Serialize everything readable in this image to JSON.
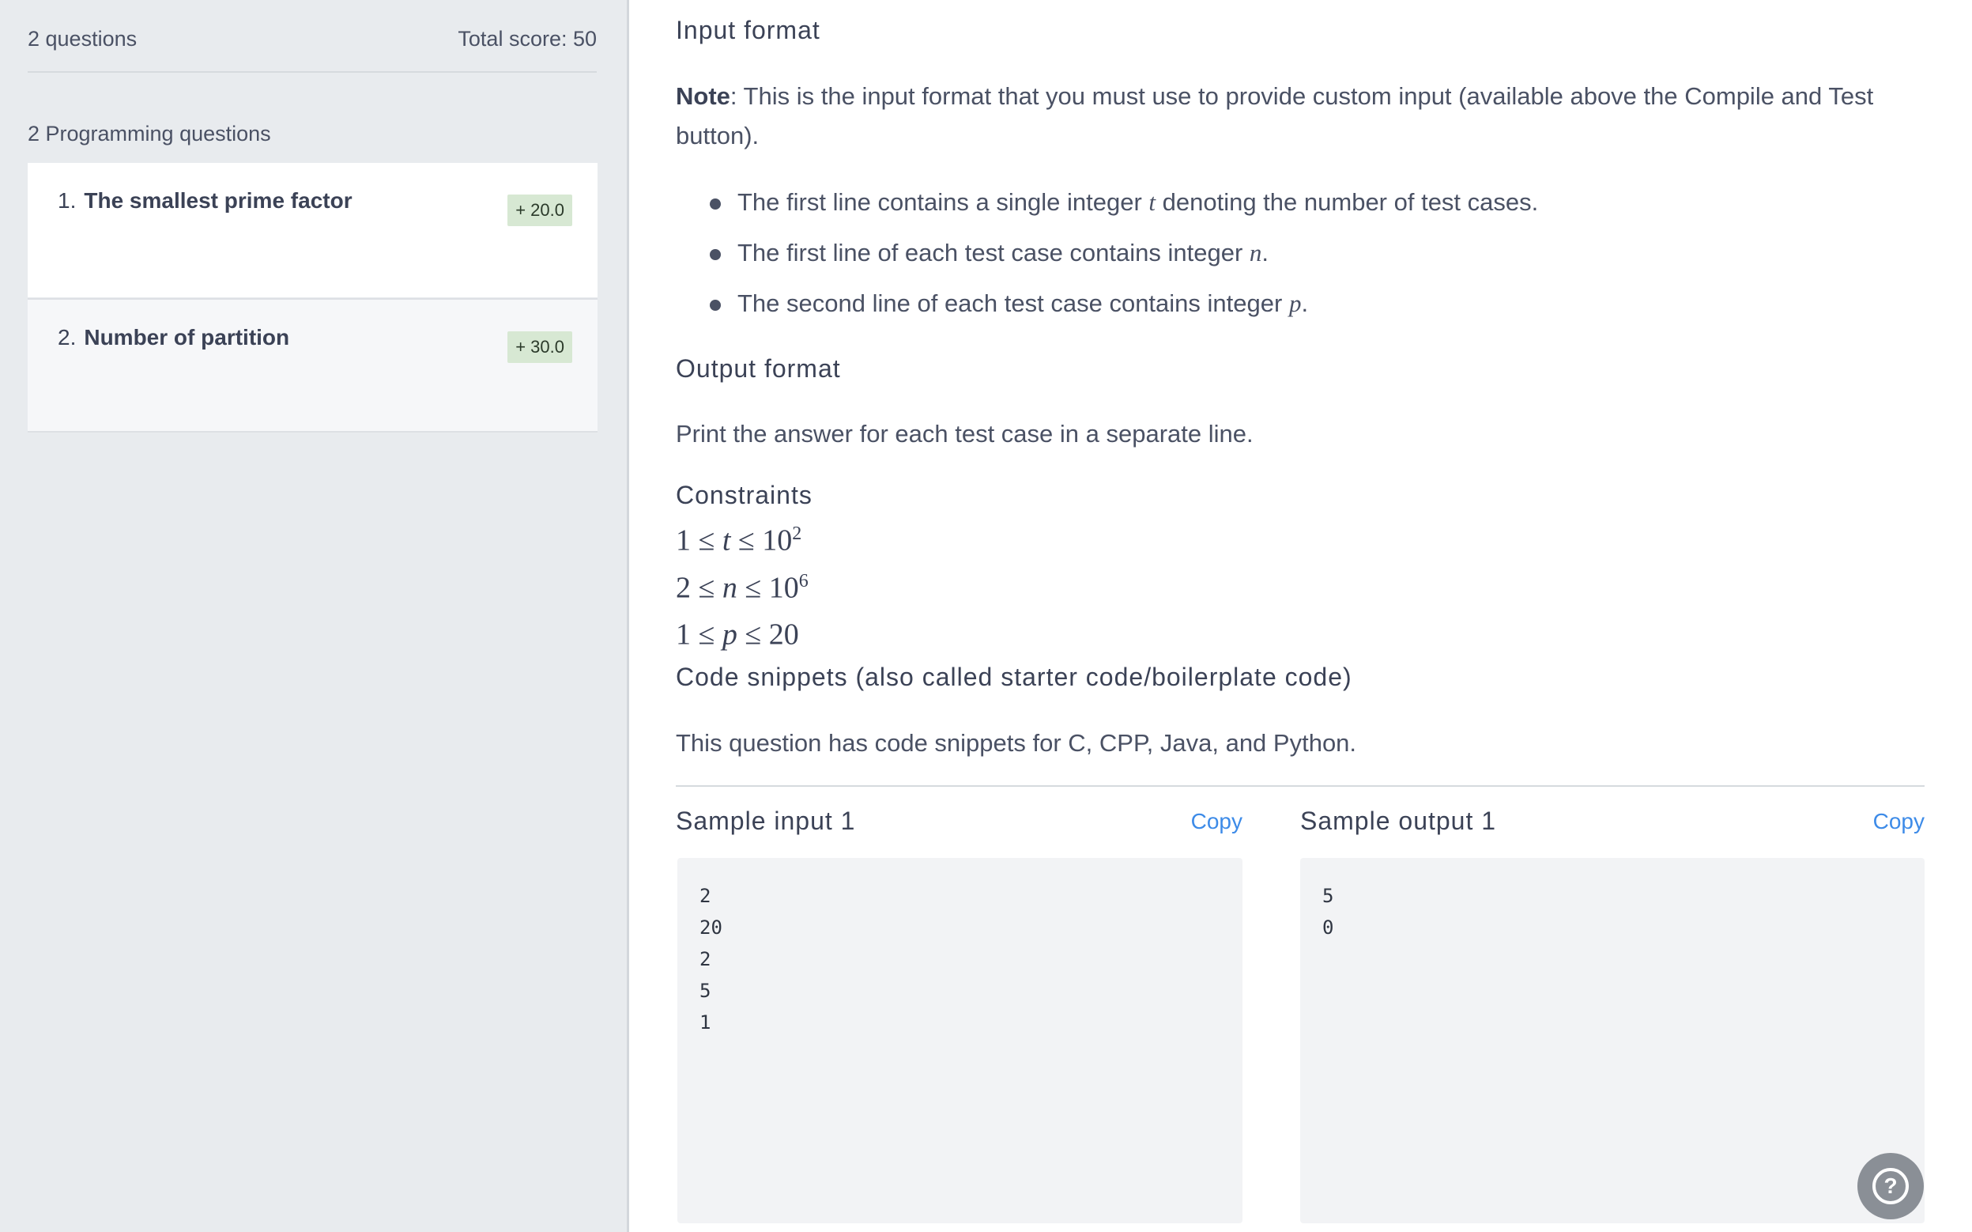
{
  "sidebar": {
    "question_count": "2 questions",
    "total_score": "Total score: 50",
    "section_label": "2 Programming questions",
    "questions": [
      {
        "number": "1.",
        "title": "The smallest prime factor",
        "score": "+ 20.0"
      },
      {
        "number": "2.",
        "title": "Number of partition",
        "score": "+ 30.0"
      }
    ]
  },
  "main": {
    "input_format": {
      "heading": "Input format",
      "note_label": "Note",
      "note_text": ": This is the input format that you must use to provide custom input (available above the Compile and Test button).",
      "bullets": [
        {
          "pre": "The first line contains a single integer ",
          "var": "t",
          "post": " denoting the number of test cases."
        },
        {
          "pre": "The first line of each test case contains integer ",
          "var": "n",
          "post": "."
        },
        {
          "pre": "The second line of each test case contains integer ",
          "var": "p",
          "post": "."
        }
      ]
    },
    "output_format": {
      "heading": "Output format",
      "text": "Print the answer for each test case in a separate line."
    },
    "constraints": {
      "heading": "Constraints",
      "lines": [
        {
          "lhs": "1 ≤ ",
          "var": "t",
          "rhs": " ≤ 10",
          "exp": "2"
        },
        {
          "lhs": "2 ≤ ",
          "var": "n",
          "rhs": " ≤ 10",
          "exp": "6"
        },
        {
          "lhs": "1 ≤ ",
          "var": "p",
          "rhs": " ≤ 20",
          "exp": ""
        }
      ]
    },
    "code_snippets": {
      "heading": "Code snippets (also called starter code/boilerplate code)",
      "text": "This question has code snippets for C, CPP, Java, and Python."
    },
    "sample_input": {
      "title": "Sample input 1",
      "copy_label": "Copy",
      "content": "2\n20\n2\n5\n1"
    },
    "sample_output": {
      "title": "Sample output 1",
      "copy_label": "Copy",
      "content": "5\n0"
    }
  },
  "help_button": {
    "icon": "question-icon",
    "glyph": "?"
  }
}
